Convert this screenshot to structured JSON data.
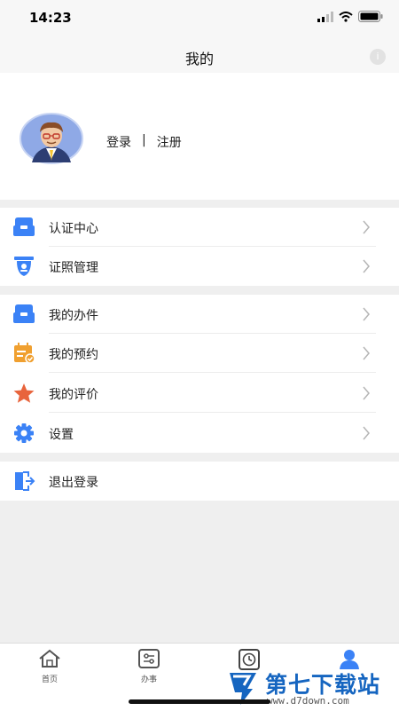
{
  "status_bar": {
    "time": "14:23"
  },
  "nav": {
    "title": "我的"
  },
  "profile": {
    "login": "登录",
    "divider": "|",
    "register": "注册"
  },
  "group1": [
    {
      "label": "认证中心",
      "icon": "auth-center-icon"
    },
    {
      "label": "证照管理",
      "icon": "license-icon"
    }
  ],
  "group2": [
    {
      "label": "我的办件",
      "icon": "my-cases-icon"
    },
    {
      "label": "我的预约",
      "icon": "calendar-icon"
    },
    {
      "label": "我的评价",
      "icon": "star-icon"
    },
    {
      "label": "设置",
      "icon": "gear-icon"
    }
  ],
  "group3": [
    {
      "label": "退出登录",
      "icon": "logout-icon"
    }
  ],
  "tabs": [
    {
      "label": "首页",
      "icon": "home-icon"
    },
    {
      "label": "办事",
      "icon": "services-icon"
    },
    {
      "label": "",
      "icon": "clock-icon"
    },
    {
      "label": "",
      "icon": "user-icon"
    }
  ],
  "watermark": {
    "main": "第七下载站",
    "sub": "www.d7down.com"
  },
  "colors": {
    "accent": "#3b82f6",
    "orange": "#f0a030",
    "star": "#e8643c"
  }
}
